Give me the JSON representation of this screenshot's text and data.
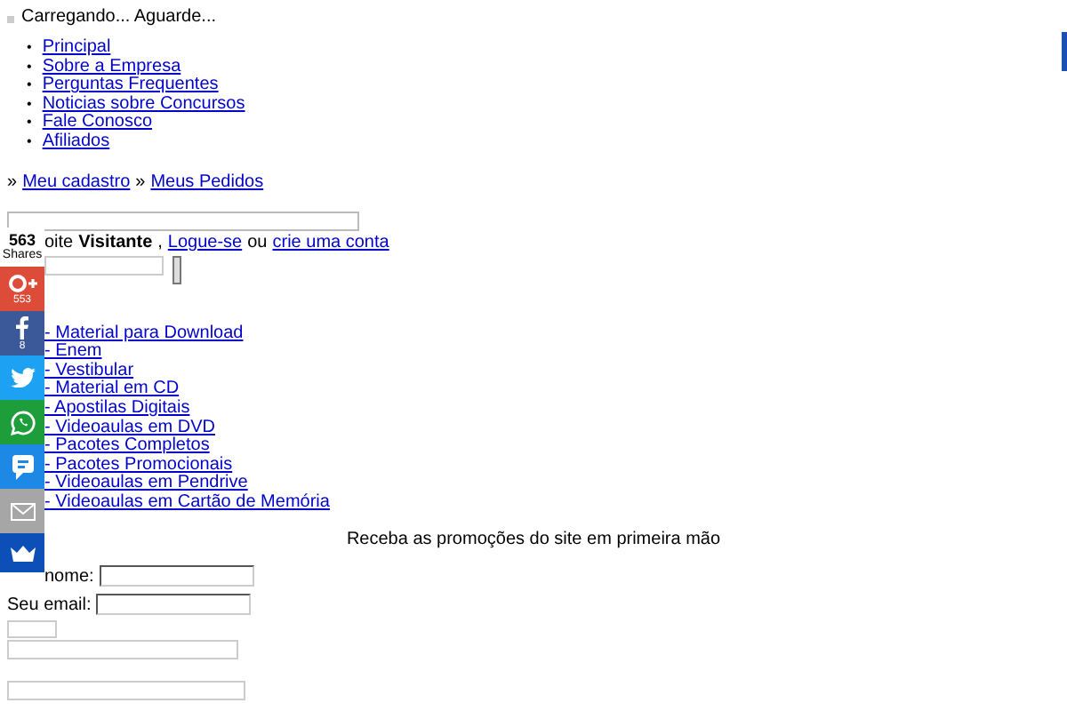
{
  "loading": {
    "text": "Carregando... Aguarde..."
  },
  "nav": [
    {
      "bullet": "•",
      "label": "Principal"
    },
    {
      "bullet": "•",
      "label": "Sobre a Empresa"
    },
    {
      "bullet": "•",
      "label": "Perguntas Frequentes"
    },
    {
      "bullet": "•",
      "label": "Noticias sobre Concursos"
    },
    {
      "bullet": "•",
      "label": "Fale Conosco"
    },
    {
      "bullet": "•",
      "label": "Afiliados"
    }
  ],
  "breadcrumb": [
    {
      "sep": "»",
      "label": "Meu cadastro"
    },
    {
      "sep": "»",
      "label": "Meus Pedidos"
    }
  ],
  "welcome": {
    "before": "oite",
    "name": "Visitante",
    "comma": ",",
    "login": "Logue-se",
    "or": "ou",
    "signup": "crie uma conta"
  },
  "share": {
    "count": "563",
    "label": "Shares",
    "buttons": [
      {
        "kind": "googleplus",
        "color": "#dd4b39",
        "count": "553"
      },
      {
        "kind": "facebook",
        "color": "#3b5998",
        "count": "8"
      },
      {
        "kind": "twitter",
        "color": "#1da1f2"
      },
      {
        "kind": "whatsapp",
        "color": "#1e9e3a"
      },
      {
        "kind": "messenger",
        "color": "#1e88e5"
      },
      {
        "kind": "email",
        "color": "#a6a6a6"
      },
      {
        "kind": "crown",
        "color": "#0c4fb7"
      }
    ]
  },
  "categories": [
    "- Material para Download",
    "- Enem",
    "- Vestibular",
    "- Material em CD",
    "- Apostilas Digitais",
    "- Videoaulas em DVD",
    "- Pacotes Completos",
    "- Pacotes Promocionais",
    "- Videoaulas em Pendrive",
    "- Videoaulas em Cartão de Memória"
  ],
  "newsletter": {
    "heading": "Receba as promoções do site em primeira mão",
    "name_label": "nome:",
    "email_label": "Seu email:"
  }
}
